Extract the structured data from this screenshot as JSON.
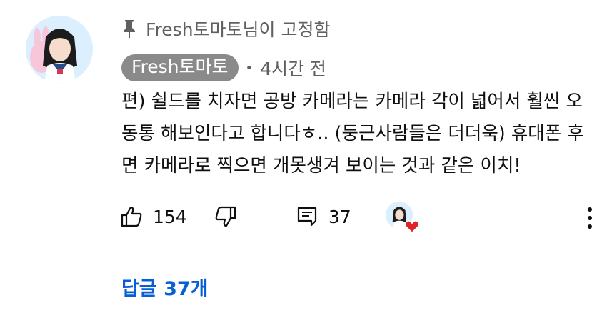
{
  "pinned": {
    "text": "Fresh토마토님이 고정함",
    "icon": "pin-icon"
  },
  "author": {
    "name": "Fresh토마토",
    "time": "4시간 전"
  },
  "comment": {
    "lines": [
      "편) 쉴드를 치자면 공방 카메라는 카메라 각이 넓어서 훨씬 오",
      "동통 해보인다고 합니다ㅎ.. (둥근사람들은 더더욱) 휴대폰 후",
      "면 카메라로 찍으면 개못생겨 보이는 것과 같은 이치!"
    ]
  },
  "actions": {
    "likes": "154",
    "replies_count": "37",
    "like_icon": "thumbs-up-icon",
    "dislike_icon": "thumbs-down-icon",
    "reply_icon": "comment-icon",
    "more_icon": "more-vertical-icon"
  },
  "replies_link": "답글 37개",
  "colors": {
    "accent": "#065fd4",
    "chip": "#8a8a8a",
    "heart": "#e0222a"
  }
}
